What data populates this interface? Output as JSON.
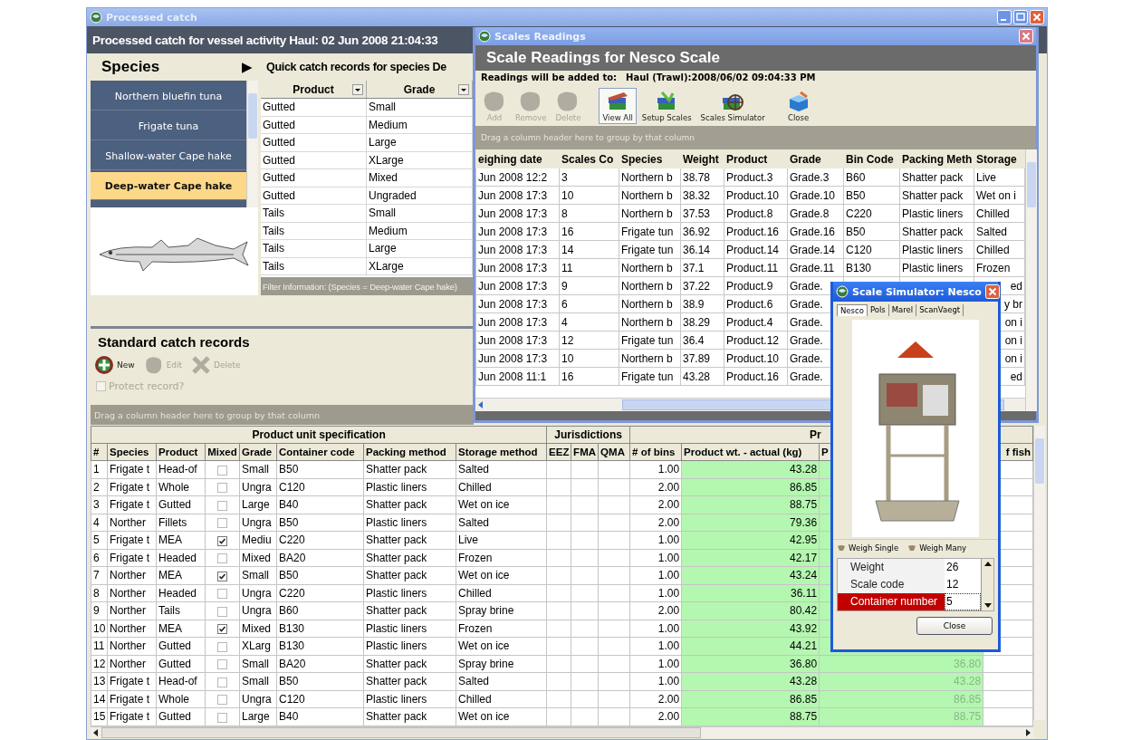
{
  "main_window": {
    "title": "Processed catch",
    "heading": "Processed catch for vessel activity Haul: 02 Jun 2008 21:04:33",
    "species_panel": {
      "title": "Species",
      "arrow": "▶",
      "items": [
        {
          "label": "Northern bluefin tuna",
          "selected": false
        },
        {
          "label": "Frigate tuna",
          "selected": false
        },
        {
          "label": "Shallow-water Cape hake",
          "selected": false
        },
        {
          "label": "Deep-water Cape hake",
          "selected": true
        }
      ]
    },
    "quick_catch": {
      "title": "Quick catch records for species De",
      "columns": [
        "Product",
        "Grade"
      ],
      "rows": [
        [
          "Gutted",
          "Small"
        ],
        [
          "Gutted",
          "Medium"
        ],
        [
          "Gutted",
          "Large"
        ],
        [
          "Gutted",
          "XLarge"
        ],
        [
          "Gutted",
          "Mixed"
        ],
        [
          "Gutted",
          "Ungraded"
        ],
        [
          "Tails",
          "Small"
        ],
        [
          "Tails",
          "Medium"
        ],
        [
          "Tails",
          "Large"
        ],
        [
          "Tails",
          "XLarge"
        ]
      ],
      "filter_info": "Filter Information: (Species = Deep-water Cape hake)"
    },
    "standard_catch": {
      "title": "Standard catch records",
      "toolbar": [
        {
          "kind": "new",
          "label": "New",
          "disabled": false
        },
        {
          "kind": "edit",
          "label": "Edit",
          "disabled": true
        },
        {
          "kind": "delete",
          "label": "Delete",
          "disabled": true
        }
      ],
      "protect": {
        "label": "Protect record?",
        "checked": false,
        "disabled": true
      },
      "group_hint": "Drag a column header here to group by that column",
      "column_groups": [
        {
          "label": "Product unit specification",
          "columns": [
            {
              "label": "#",
              "kind": "text"
            },
            {
              "label": "Species",
              "kind": "text"
            },
            {
              "label": "Product",
              "kind": "text"
            },
            {
              "label": "Mixed",
              "kind": "check"
            },
            {
              "label": "Grade",
              "kind": "text"
            },
            {
              "label": "Container code",
              "kind": "text"
            },
            {
              "label": "Packing method",
              "kind": "text"
            },
            {
              "label": "Storage method",
              "kind": "text"
            }
          ]
        },
        {
          "label": "Jurisdictions",
          "columns": [
            {
              "label": "EEZ",
              "kind": "text"
            },
            {
              "label": "FMA",
              "kind": "text"
            },
            {
              "label": "QMA",
              "kind": "text"
            }
          ]
        },
        {
          "label": "Pr",
          "columns": [
            {
              "label": "# of bins",
              "kind": "number"
            },
            {
              "label": "Product wt. - actual (kg)",
              "kind": "weight"
            },
            {
              "label": "P",
              "kind": "computed"
            },
            {
              "label": "f fish",
              "kind": "end"
            }
          ]
        }
      ],
      "rows": [
        {
          "number": "1",
          "species": "Frigate t",
          "product": "Head-of",
          "mixed": false,
          "grade": "Small",
          "container_code": "B50",
          "packing_method": "Shatter pack",
          "storage_method": "Salted",
          "bins": "1.00",
          "product_wt_actual": "43.28"
        },
        {
          "number": "2",
          "species": "Frigate t",
          "product": "Whole",
          "mixed": false,
          "grade": "Ungra",
          "container_code": "C120",
          "packing_method": "Plastic liners",
          "storage_method": "Chilled",
          "bins": "2.00",
          "product_wt_actual": "86.85"
        },
        {
          "number": "3",
          "species": "Frigate t",
          "product": "Gutted",
          "mixed": false,
          "grade": "Large",
          "container_code": "B40",
          "packing_method": "Shatter pack",
          "storage_method": "Wet on ice",
          "bins": "2.00",
          "product_wt_actual": "88.75"
        },
        {
          "number": "4",
          "species": "Norther",
          "product": "Fillets",
          "mixed": false,
          "grade": "Ungra",
          "container_code": "B50",
          "packing_method": "Plastic liners",
          "storage_method": "Salted",
          "bins": "2.00",
          "product_wt_actual": "79.36"
        },
        {
          "number": "5",
          "species": "Frigate t",
          "product": "MEA",
          "mixed": true,
          "grade": "Mediu",
          "container_code": "C220",
          "packing_method": "Shatter pack",
          "storage_method": "Live",
          "bins": "1.00",
          "product_wt_actual": "42.95"
        },
        {
          "number": "6",
          "species": "Frigate t",
          "product": "Headed",
          "mixed": false,
          "grade": "Mixed",
          "container_code": "BA20",
          "packing_method": "Shatter pack",
          "storage_method": "Frozen",
          "bins": "1.00",
          "product_wt_actual": "42.17"
        },
        {
          "number": "7",
          "species": "Norther",
          "product": "MEA",
          "mixed": true,
          "grade": "Small",
          "container_code": "B50",
          "packing_method": "Shatter pack",
          "storage_method": "Wet on ice",
          "bins": "1.00",
          "product_wt_actual": "43.24"
        },
        {
          "number": "8",
          "species": "Norther",
          "product": "Headed",
          "mixed": false,
          "grade": "Ungra",
          "container_code": "C220",
          "packing_method": "Plastic liners",
          "storage_method": "Chilled",
          "bins": "1.00",
          "product_wt_actual": "36.11"
        },
        {
          "number": "9",
          "species": "Norther",
          "product": "Tails",
          "mixed": false,
          "grade": "Ungra",
          "container_code": "B60",
          "packing_method": "Shatter pack",
          "storage_method": "Spray brine",
          "bins": "2.00",
          "product_wt_actual": "80.42"
        },
        {
          "number": "10",
          "species": "Norther",
          "product": "MEA",
          "mixed": true,
          "grade": "Mixed",
          "container_code": "B130",
          "packing_method": "Plastic liners",
          "storage_method": "Frozen",
          "bins": "1.00",
          "product_wt_actual": "43.92"
        },
        {
          "number": "11",
          "species": "Norther",
          "product": "Gutted",
          "mixed": false,
          "grade": "XLarg",
          "container_code": "B130",
          "packing_method": "Plastic liners",
          "storage_method": "Wet on ice",
          "bins": "1.00",
          "product_wt_actual": "44.21"
        },
        {
          "number": "12",
          "species": "Norther",
          "product": "Gutted",
          "mixed": false,
          "grade": "Small",
          "container_code": "BA20",
          "packing_method": "Shatter pack",
          "storage_method": "Spray brine",
          "bins": "1.00",
          "product_wt_actual": "36.80",
          "column_14": "36.80"
        },
        {
          "number": "13",
          "species": "Frigate t",
          "product": "Head-of",
          "mixed": false,
          "grade": "Small",
          "container_code": "B50",
          "packing_method": "Shatter pack",
          "storage_method": "Salted",
          "bins": "1.00",
          "product_wt_actual": "43.28",
          "column_14": "43.28"
        },
        {
          "number": "14",
          "species": "Frigate t",
          "product": "Whole",
          "mixed": false,
          "grade": "Ungra",
          "container_code": "C120",
          "packing_method": "Plastic liners",
          "storage_method": "Chilled",
          "bins": "2.00",
          "product_wt_actual": "86.85",
          "column_14": "86.85"
        },
        {
          "number": "15",
          "species": "Frigate t",
          "product": "Gutted",
          "mixed": false,
          "grade": "Large",
          "container_code": "B40",
          "packing_method": "Shatter pack",
          "storage_method": "Wet on ice",
          "bins": "2.00",
          "product_wt_actual": "88.75",
          "column_14": "88.75"
        }
      ]
    }
  },
  "scales_window": {
    "title": "Scales Readings",
    "heading": "Scale Readings for Nesco Scale",
    "target_label": "Readings will be added to:",
    "target_value": "Haul (Trawl):2008/06/02 09:04:33 PM",
    "toolbar": [
      {
        "kind": "add",
        "label": "Add",
        "disabled": true,
        "selected": false
      },
      {
        "kind": "remove",
        "label": "Remove",
        "disabled": true,
        "selected": false
      },
      {
        "kind": "delete",
        "label": "Delete",
        "disabled": true,
        "selected": false
      },
      {
        "kind": "view",
        "label": "View All",
        "disabled": false,
        "selected": true
      },
      {
        "kind": "setup",
        "label": "Setup Scales",
        "disabled": false,
        "selected": false
      },
      {
        "kind": "simulator",
        "label": "Scales Simulator",
        "disabled": false,
        "selected": false
      },
      {
        "kind": "close",
        "label": "Close",
        "disabled": false,
        "selected": false
      }
    ],
    "group_hint": "Drag a column header here to group by that column",
    "columns": [
      "eighing date",
      "Scales Co",
      "Species",
      "Weight",
      "Product",
      "Grade",
      "Bin Code",
      "Packing Meth",
      "Storage"
    ],
    "rows": [
      {
        "cells": [
          "Jun 2008 12:2",
          "3",
          "Northern b",
          "38.78",
          "Product.3",
          "Grade.3",
          "B60",
          "Shatter pack",
          "Live"
        ]
      },
      {
        "cells": [
          "Jun 2008 17:3",
          "10",
          "Northern b",
          "38.32",
          "Product.10",
          "Grade.10",
          "B50",
          "Shatter pack",
          "Wet on i"
        ]
      },
      {
        "cells": [
          "Jun 2008 17:3",
          "8",
          "Northern b",
          "37.53",
          "Product.8",
          "Grade.8",
          "C220",
          "Plastic liners",
          "Chilled"
        ]
      },
      {
        "cells": [
          "Jun 2008 17:3",
          "16",
          "Frigate tun",
          "36.92",
          "Product.16",
          "Grade.16",
          "B50",
          "Shatter pack",
          "Salted"
        ]
      },
      {
        "cells": [
          "Jun 2008 17:3",
          "14",
          "Frigate tun",
          "36.14",
          "Product.14",
          "Grade.14",
          "C120",
          "Plastic liners",
          "Chilled"
        ]
      },
      {
        "cells": [
          "Jun 2008 17:3",
          "11",
          "Northern b",
          "37.1",
          "Product.11",
          "Grade.11",
          "B130",
          "Plastic liners",
          "Frozen"
        ]
      },
      {
        "cells": [
          "Jun 2008 17:3",
          "9",
          "Northern b",
          "37.22",
          "Product.9",
          "Grade."
        ],
        "tail": "ed"
      },
      {
        "cells": [
          "Jun 2008 17:3",
          "6",
          "Northern b",
          "38.9",
          "Product.6",
          "Grade."
        ],
        "tail": "y br"
      },
      {
        "cells": [
          "Jun 2008 17:3",
          "4",
          "Northern b",
          "38.29",
          "Product.4",
          "Grade."
        ],
        "tail": "on i"
      },
      {
        "cells": [
          "Jun 2008 17:3",
          "12",
          "Frigate tun",
          "36.4",
          "Product.12",
          "Grade."
        ],
        "tail": "on i"
      },
      {
        "cells": [
          "Jun 2008 17:3",
          "10",
          "Northern b",
          "37.89",
          "Product.10",
          "Grade."
        ],
        "tail": "on i"
      },
      {
        "cells": [
          "Jun 2008 11:1",
          "16",
          "Frigate tun",
          "43.28",
          "Product.16",
          "Grade."
        ],
        "tail": "ed"
      }
    ]
  },
  "scale_simulator": {
    "title": "Scale Simulator: Nesco",
    "tabs": [
      {
        "label": "Nesco",
        "selected": true
      },
      {
        "label": "Pols",
        "selected": false
      },
      {
        "label": "Marel",
        "selected": false
      },
      {
        "label": "ScanVaegt",
        "selected": false
      }
    ],
    "options": [
      {
        "label": "Weigh Single"
      },
      {
        "label": "Weigh Many"
      }
    ],
    "properties": [
      {
        "name": "Weight",
        "value": "26",
        "selected": false
      },
      {
        "name": "Scale code",
        "value": "12",
        "selected": false
      },
      {
        "name": "Container number",
        "value": "5",
        "selected": true
      }
    ],
    "close_label": "Close"
  }
}
